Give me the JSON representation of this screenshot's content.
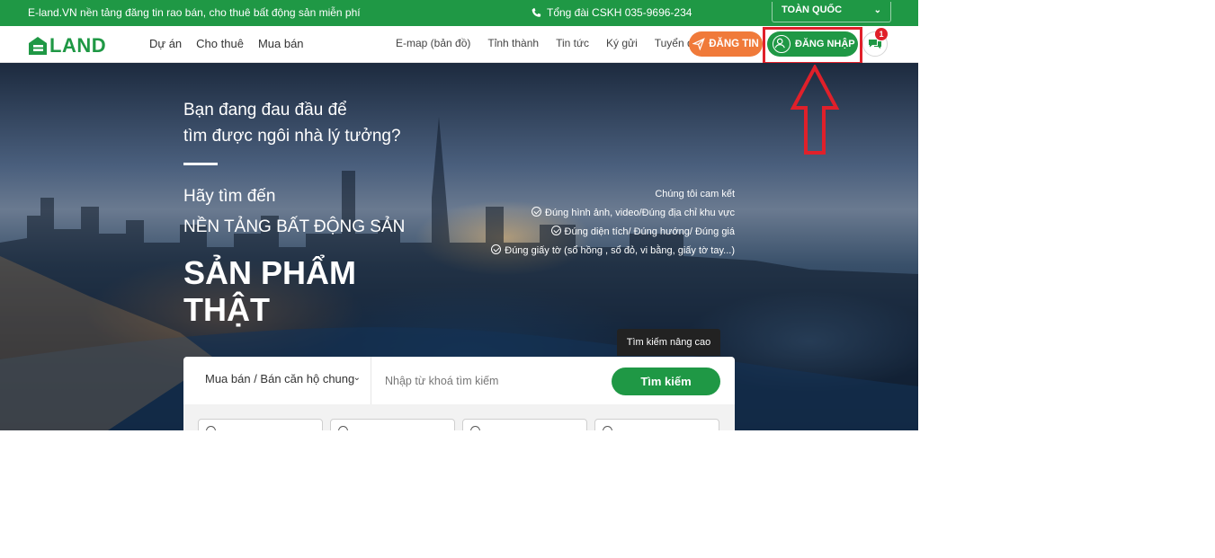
{
  "topbar": {
    "tagline": "E-land.VN nền tảng đăng tin rao bán, cho thuê bất động sản miễn phí",
    "hotline": "Tổng đài CSKH 035-9696-234",
    "region": "TOÀN QUỐC",
    "phone_icon": "phone-icon",
    "region_icon": "chevron-down-icon"
  },
  "logo": {
    "text": "LAND"
  },
  "nav": {
    "left": [
      "Dự án",
      "Cho thuê",
      "Mua bán"
    ],
    "right": [
      "E-map (bản đồ)",
      "Tỉnh thành",
      "Tin tức",
      "Ký gửi",
      "Tuyển dụng"
    ],
    "post_button": "ĐĂNG TIN",
    "login_button": "ĐĂNG NHẬP",
    "chat_badge": "1"
  },
  "hero": {
    "question_line1": "Bạn đang đau đầu để",
    "question_line2": "tìm được ngôi nhà lý tưởng?",
    "find_line": "Hãy tìm đến",
    "platform_line": "NỀN TẢNG BẤT ĐỘNG SẢN",
    "big_line1": "SẢN PHẨM",
    "big_line2": "THẬT",
    "commit_title": "Chúng tôi cam kết",
    "commitments": [
      "Đúng hình ảnh, video/Đúng địa chỉ khu vực",
      "Đúng diện tích/ Đúng hướng/ Đúng giá",
      "Đúng giấy tờ (sổ hồng , sổ đỏ, vi bằng, giấy tờ tay...)"
    ]
  },
  "search": {
    "advanced_label": "Tìm kiếm nâng cao",
    "category": "Mua bán / Bán căn hộ chung",
    "keyword_placeholder": "Nhập từ khoá tìm kiếm",
    "submit": "Tìm kiếm"
  },
  "colors": {
    "brand_green": "#1f9845",
    "post_orange": "#f07a3a",
    "annotation_red": "#e0202a"
  }
}
